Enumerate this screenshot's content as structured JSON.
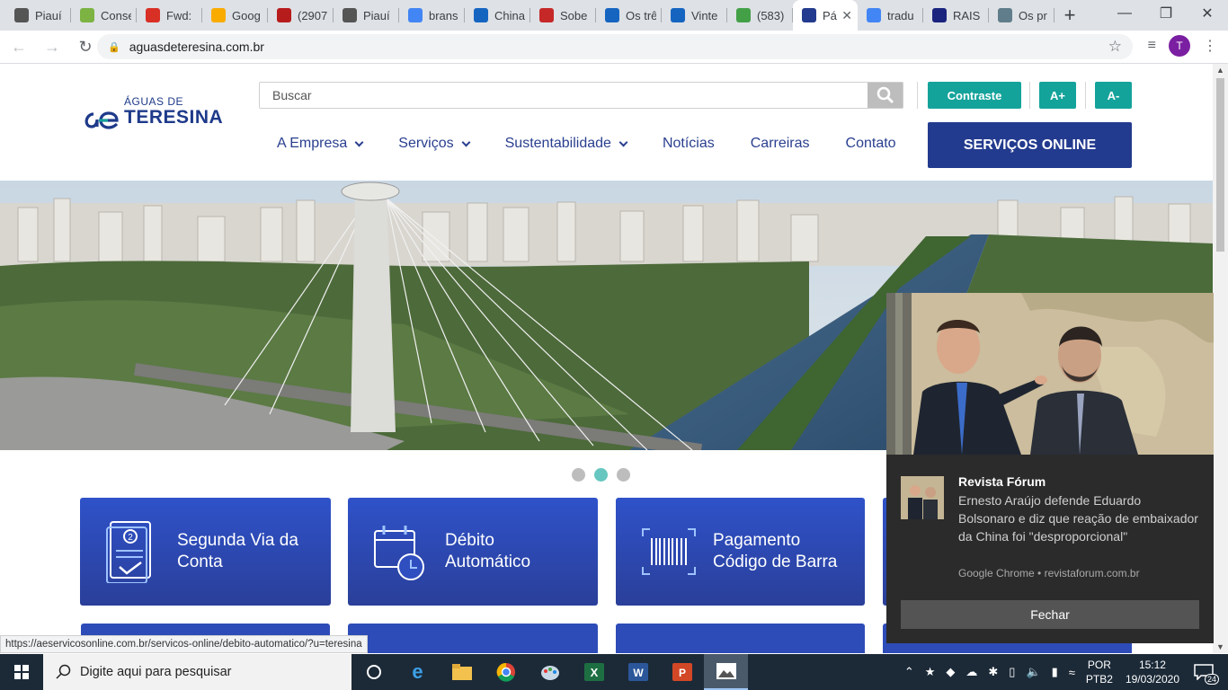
{
  "browser": {
    "tabs": [
      {
        "title": "Piauí",
        "color": "#555"
      },
      {
        "title": "Conse",
        "color": "#7cb342"
      },
      {
        "title": "Fwd:",
        "color": "#d93025"
      },
      {
        "title": "Goog",
        "color": "#f9ab00"
      },
      {
        "title": "(2907",
        "color": "#b71c1c"
      },
      {
        "title": "Piauí",
        "color": "#555"
      },
      {
        "title": "brans",
        "color": "#4285f4"
      },
      {
        "title": "China",
        "color": "#1565c0"
      },
      {
        "title": "Sobe",
        "color": "#c62828"
      },
      {
        "title": "Os trê",
        "color": "#1565c0"
      },
      {
        "title": "Vinte",
        "color": "#1565c0"
      },
      {
        "title": "(583)",
        "color": "#43a047"
      },
      {
        "title": "Pá",
        "color": "#233b8e",
        "active": true
      },
      {
        "title": "tradu",
        "color": "#4285f4"
      },
      {
        "title": "RAIS",
        "color": "#1a237e"
      },
      {
        "title": "Os pr",
        "color": "#607d8b"
      }
    ],
    "url": "aguasdeteresina.com.br",
    "profile_initial": "T",
    "status_url": "https://aeservicosonline.com.br/servicos-online/debito-automatico/?u=teresina"
  },
  "site": {
    "logo_small": "ÁGUAS DE",
    "logo_big": "TERESINA",
    "search_placeholder": "Buscar",
    "contrast_label": "Contraste",
    "font_up_label": "A+",
    "font_down_label": "A-",
    "nav": [
      {
        "label": "A Empresa",
        "dropdown": true
      },
      {
        "label": "Serviços",
        "dropdown": true
      },
      {
        "label": "Sustentabilidade",
        "dropdown": true
      },
      {
        "label": "Notícias",
        "dropdown": false
      },
      {
        "label": "Carreiras",
        "dropdown": false
      },
      {
        "label": "Contato",
        "dropdown": false
      }
    ],
    "online_button": "SERVIÇOS ONLINE",
    "carousel_active_index": 1,
    "cards": [
      {
        "line1": "Segunda Via da",
        "line2": "Conta",
        "icon": "bill-icon"
      },
      {
        "line1": "Débito",
        "line2": "Automático",
        "icon": "calendar-clock-icon"
      },
      {
        "line1": "Pagamento",
        "line2": "Código de Barra",
        "icon": "barcode-icon"
      }
    ]
  },
  "notification": {
    "source": "Revista Fórum",
    "message": "Ernesto Araújo defende Eduardo Bolsonaro e diz que reação de embaixador da China foi \"desproporcional\"",
    "meta": "Google Chrome • revistaforum.com.br",
    "close_label": "Fechar"
  },
  "taskbar": {
    "search_placeholder": "Digite aqui para pesquisar",
    "lang_line1": "POR",
    "lang_line2": "PTB2",
    "time": "15:12",
    "date": "19/03/2020",
    "notification_count": "24"
  }
}
